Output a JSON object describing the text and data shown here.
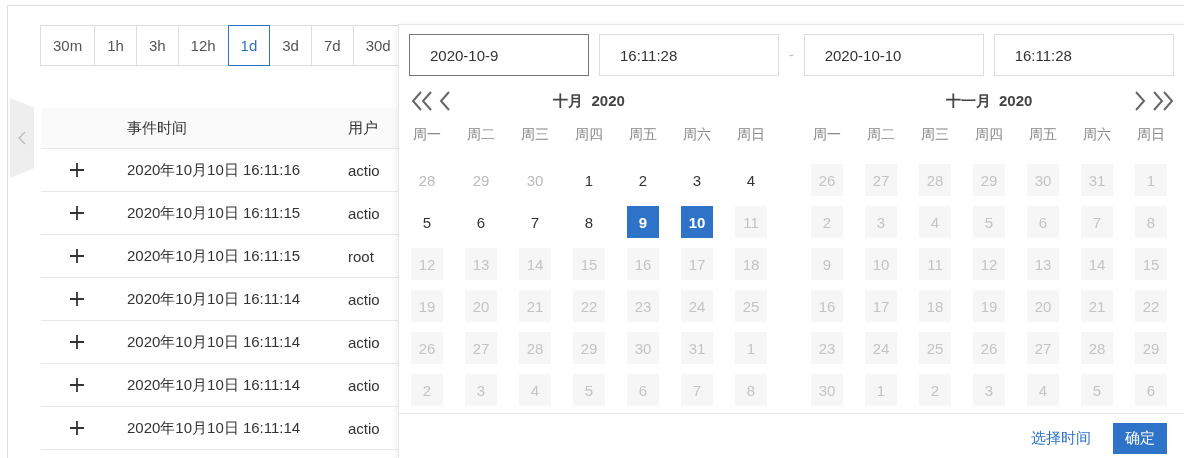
{
  "ranges": [
    {
      "label": "30m",
      "selected": false
    },
    {
      "label": "1h",
      "selected": false
    },
    {
      "label": "3h",
      "selected": false
    },
    {
      "label": "12h",
      "selected": false
    },
    {
      "label": "1d",
      "selected": true
    },
    {
      "label": "3d",
      "selected": false
    },
    {
      "label": "7d",
      "selected": false
    },
    {
      "label": "30d",
      "selected": false
    }
  ],
  "table": {
    "columns": [
      "事件时间",
      "用户"
    ],
    "rows": [
      {
        "time": "2020年10月10日 16:11:16",
        "user": "actio"
      },
      {
        "time": "2020年10月10日 16:11:15",
        "user": "actio"
      },
      {
        "time": "2020年10月10日 16:11:15",
        "user": "root"
      },
      {
        "time": "2020年10月10日 16:11:14",
        "user": "actio"
      },
      {
        "time": "2020年10月10日 16:11:14",
        "user": "actio"
      },
      {
        "time": "2020年10月10日 16:11:14",
        "user": "actio"
      },
      {
        "time": "2020年10月10日 16:11:14",
        "user": "actio"
      }
    ]
  },
  "picker": {
    "start_date": {
      "value": "2020-10-9",
      "focused": true
    },
    "start_time": {
      "value": "16:11:28",
      "focused": false
    },
    "separator": "-",
    "end_date": {
      "value": "2020-10-10",
      "focused": false
    },
    "end_time": {
      "value": "16:11:28",
      "focused": false
    },
    "months": [
      {
        "title": "十月  2020",
        "weekdays": [
          "周一",
          "周二",
          "周三",
          "周四",
          "周五",
          "周六",
          "周日"
        ],
        "weeks": [
          [
            {
              "label": "28",
              "kind": "outside",
              "selected": false
            },
            {
              "label": "29",
              "kind": "outside",
              "selected": false
            },
            {
              "label": "30",
              "kind": "outside",
              "selected": false
            },
            {
              "label": "1",
              "kind": "day",
              "selected": false
            },
            {
              "label": "2",
              "kind": "day",
              "selected": false
            },
            {
              "label": "3",
              "kind": "day",
              "selected": false
            },
            {
              "label": "4",
              "kind": "day",
              "selected": false
            }
          ],
          [
            {
              "label": "5",
              "kind": "day",
              "selected": false
            },
            {
              "label": "6",
              "kind": "day",
              "selected": false
            },
            {
              "label": "7",
              "kind": "day",
              "selected": false
            },
            {
              "label": "8",
              "kind": "day",
              "selected": false
            },
            {
              "label": "9",
              "kind": "day",
              "selected": true
            },
            {
              "label": "10",
              "kind": "day",
              "selected": true
            },
            {
              "label": "11",
              "kind": "disabled",
              "selected": false
            }
          ],
          [
            {
              "label": "12",
              "kind": "disabled",
              "selected": false
            },
            {
              "label": "13",
              "kind": "disabled",
              "selected": false
            },
            {
              "label": "14",
              "kind": "disabled",
              "selected": false
            },
            {
              "label": "15",
              "kind": "disabled",
              "selected": false
            },
            {
              "label": "16",
              "kind": "disabled",
              "selected": false
            },
            {
              "label": "17",
              "kind": "disabled",
              "selected": false
            },
            {
              "label": "18",
              "kind": "disabled",
              "selected": false
            }
          ],
          [
            {
              "label": "19",
              "kind": "disabled",
              "selected": false
            },
            {
              "label": "20",
              "kind": "disabled",
              "selected": false
            },
            {
              "label": "21",
              "kind": "disabled",
              "selected": false
            },
            {
              "label": "22",
              "kind": "disabled",
              "selected": false
            },
            {
              "label": "23",
              "kind": "disabled",
              "selected": false
            },
            {
              "label": "24",
              "kind": "disabled",
              "selected": false
            },
            {
              "label": "25",
              "kind": "disabled",
              "selected": false
            }
          ],
          [
            {
              "label": "26",
              "kind": "disabled",
              "selected": false
            },
            {
              "label": "27",
              "kind": "disabled",
              "selected": false
            },
            {
              "label": "28",
              "kind": "disabled",
              "selected": false
            },
            {
              "label": "29",
              "kind": "disabled",
              "selected": false
            },
            {
              "label": "30",
              "kind": "disabled",
              "selected": false
            },
            {
              "label": "31",
              "kind": "disabled",
              "selected": false
            },
            {
              "label": "1",
              "kind": "disabled",
              "selected": false
            }
          ],
          [
            {
              "label": "2",
              "kind": "disabled",
              "selected": false
            },
            {
              "label": "3",
              "kind": "disabled",
              "selected": false
            },
            {
              "label": "4",
              "kind": "disabled",
              "selected": false
            },
            {
              "label": "5",
              "kind": "disabled",
              "selected": false
            },
            {
              "label": "6",
              "kind": "disabled",
              "selected": false
            },
            {
              "label": "7",
              "kind": "disabled",
              "selected": false
            },
            {
              "label": "8",
              "kind": "disabled",
              "selected": false
            }
          ]
        ]
      },
      {
        "title": "十一月  2020",
        "weekdays": [
          "周一",
          "周二",
          "周三",
          "周四",
          "周五",
          "周六",
          "周日"
        ],
        "weeks": [
          [
            {
              "label": "26",
              "kind": "disabled",
              "selected": false
            },
            {
              "label": "27",
              "kind": "disabled",
              "selected": false
            },
            {
              "label": "28",
              "kind": "disabled",
              "selected": false
            },
            {
              "label": "29",
              "kind": "disabled",
              "selected": false
            },
            {
              "label": "30",
              "kind": "disabled",
              "selected": false
            },
            {
              "label": "31",
              "kind": "disabled",
              "selected": false
            },
            {
              "label": "1",
              "kind": "disabled",
              "selected": false
            }
          ],
          [
            {
              "label": "2",
              "kind": "disabled",
              "selected": false
            },
            {
              "label": "3",
              "kind": "disabled",
              "selected": false
            },
            {
              "label": "4",
              "kind": "disabled",
              "selected": false
            },
            {
              "label": "5",
              "kind": "disabled",
              "selected": false
            },
            {
              "label": "6",
              "kind": "disabled",
              "selected": false
            },
            {
              "label": "7",
              "kind": "disabled",
              "selected": false
            },
            {
              "label": "8",
              "kind": "disabled",
              "selected": false
            }
          ],
          [
            {
              "label": "9",
              "kind": "disabled",
              "selected": false
            },
            {
              "label": "10",
              "kind": "disabled",
              "selected": false
            },
            {
              "label": "11",
              "kind": "disabled",
              "selected": false
            },
            {
              "label": "12",
              "kind": "disabled",
              "selected": false
            },
            {
              "label": "13",
              "kind": "disabled",
              "selected": false
            },
            {
              "label": "14",
              "kind": "disabled",
              "selected": false
            },
            {
              "label": "15",
              "kind": "disabled",
              "selected": false
            }
          ],
          [
            {
              "label": "16",
              "kind": "disabled",
              "selected": false
            },
            {
              "label": "17",
              "kind": "disabled",
              "selected": false
            },
            {
              "label": "18",
              "kind": "disabled",
              "selected": false
            },
            {
              "label": "19",
              "kind": "disabled",
              "selected": false
            },
            {
              "label": "20",
              "kind": "disabled",
              "selected": false
            },
            {
              "label": "21",
              "kind": "disabled",
              "selected": false
            },
            {
              "label": "22",
              "kind": "disabled",
              "selected": false
            }
          ],
          [
            {
              "label": "23",
              "kind": "disabled",
              "selected": false
            },
            {
              "label": "24",
              "kind": "disabled",
              "selected": false
            },
            {
              "label": "25",
              "kind": "disabled",
              "selected": false
            },
            {
              "label": "26",
              "kind": "disabled",
              "selected": false
            },
            {
              "label": "27",
              "kind": "disabled",
              "selected": false
            },
            {
              "label": "28",
              "kind": "disabled",
              "selected": false
            },
            {
              "label": "29",
              "kind": "disabled",
              "selected": false
            }
          ],
          [
            {
              "label": "30",
              "kind": "disabled",
              "selected": false
            },
            {
              "label": "1",
              "kind": "disabled",
              "selected": false
            },
            {
              "label": "2",
              "kind": "disabled",
              "selected": false
            },
            {
              "label": "3",
              "kind": "disabled",
              "selected": false
            },
            {
              "label": "4",
              "kind": "disabled",
              "selected": false
            },
            {
              "label": "5",
              "kind": "disabled",
              "selected": false
            },
            {
              "label": "6",
              "kind": "disabled",
              "selected": false
            }
          ]
        ]
      }
    ],
    "time_link": "选择时间",
    "ok_button": "确定"
  }
}
